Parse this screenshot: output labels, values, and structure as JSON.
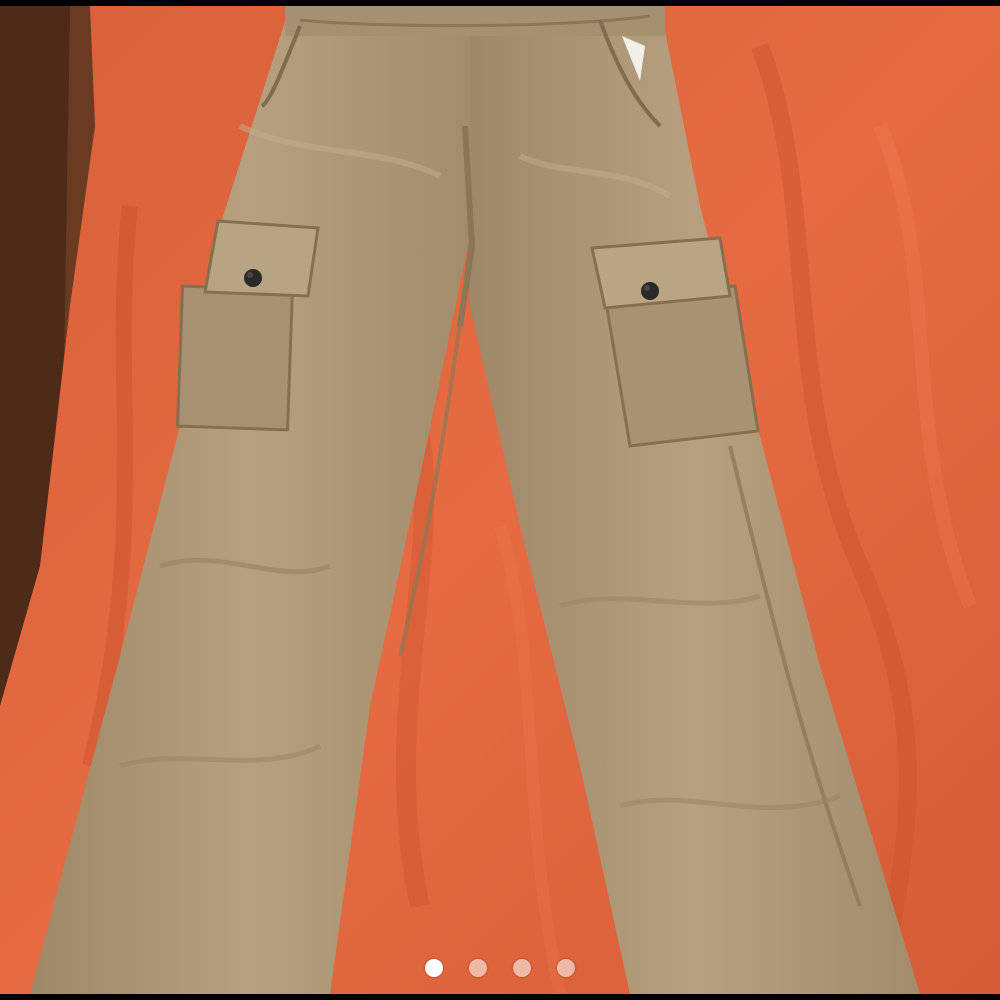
{
  "carousel": {
    "photo_subject": "khaki-cargo-pants-photo",
    "slide_count": 4,
    "active_index": 0
  },
  "colors": {
    "sheet": "#e2673f",
    "sheet_dark": "#c44e2c",
    "fabric": "#b09a79",
    "fabric_shadow": "#8f7b5e",
    "fabric_light": "#c5b091",
    "button": "#2b2a2a",
    "wood": "#5a2f1c",
    "dot_active": "#ffffff",
    "dot_inactive": "#bdbdbd"
  }
}
